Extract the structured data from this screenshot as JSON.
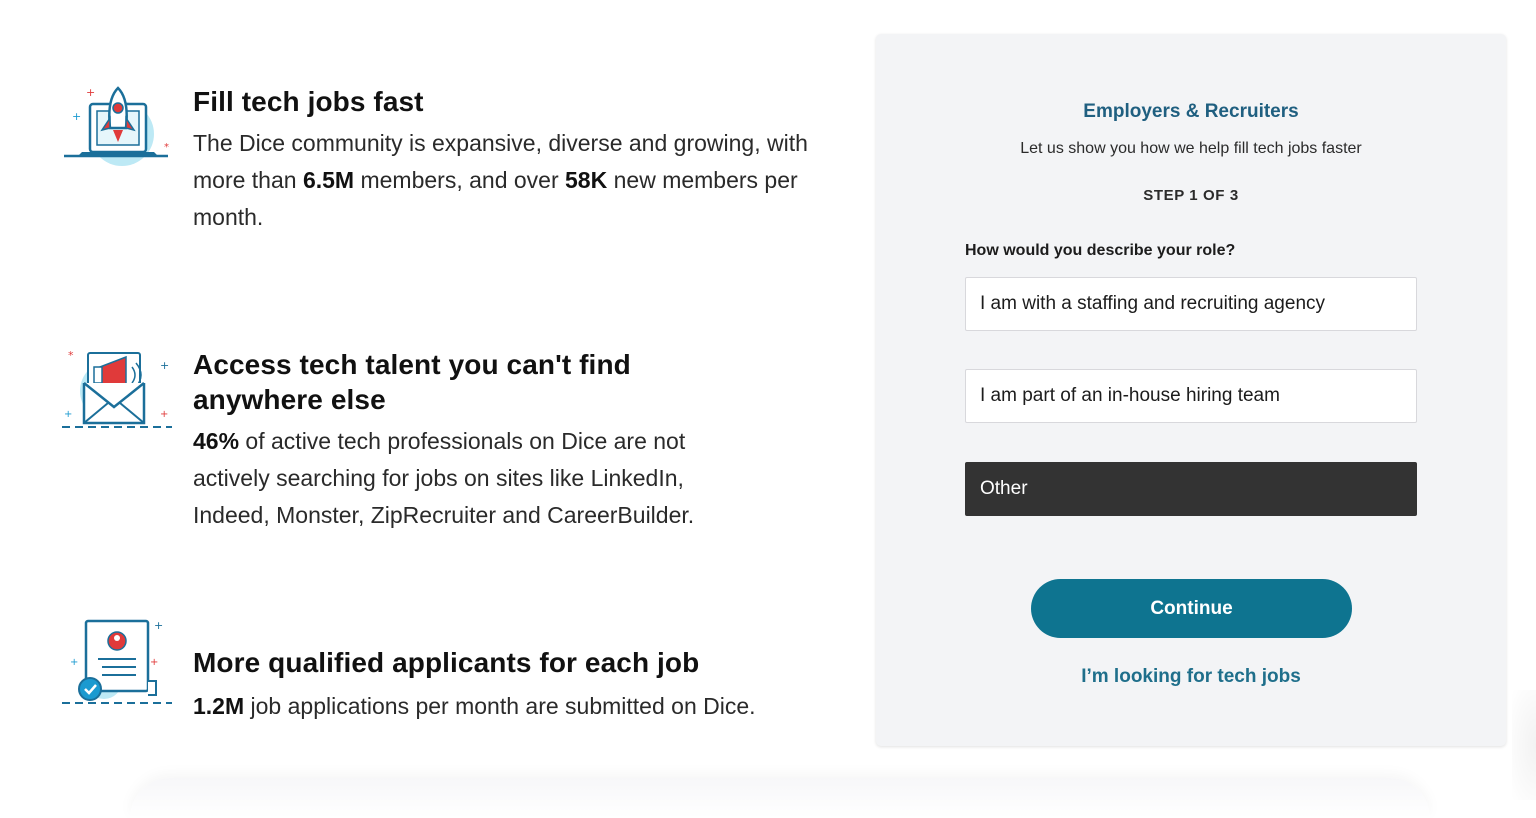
{
  "features": [
    {
      "title": "Fill tech jobs fast",
      "desc_pre": "The Dice community is expansive, diverse and growing, with more than ",
      "bold1": "6.5M",
      "desc_mid": " members, and over ",
      "bold2": "58K",
      "desc_post": " new members per month.",
      "icon": "rocket-laptop-icon"
    },
    {
      "title": "Access tech talent you can't find anywhere else",
      "bold1": "46%",
      "desc_post": " of active tech professionals on Dice are not actively searching for jobs on sites like LinkedIn, Indeed, Monster, ZipRecruiter and CareerBuilder.",
      "icon": "megaphone-envelope-icon"
    },
    {
      "title": "More qualified applicants for each job",
      "bold1": "1.2M",
      "desc_post": " job applications per month are submitted on Dice.",
      "icon": "resume-check-icon"
    }
  ],
  "panel": {
    "heading": "Employers & Recruiters",
    "subheading": "Let us show you how we help fill tech jobs faster",
    "step": "STEP 1 OF 3",
    "question": "How would you describe your role?",
    "options": [
      "I am with a staffing and recruiting agency",
      "I am part of an in-house hiring team",
      "Other"
    ],
    "selected_option": "Other",
    "continue_label": "Continue",
    "jobseeker_link": "I’m looking for tech jobs"
  },
  "colors": {
    "accent": "#0e7490",
    "heading": "#1f5f80",
    "selected_bg": "#333333",
    "panel_bg": "#f3f4f6",
    "icon_red": "#e03a3a",
    "icon_blue": "#1b6f9a",
    "icon_cyan": "#bde9f5"
  }
}
